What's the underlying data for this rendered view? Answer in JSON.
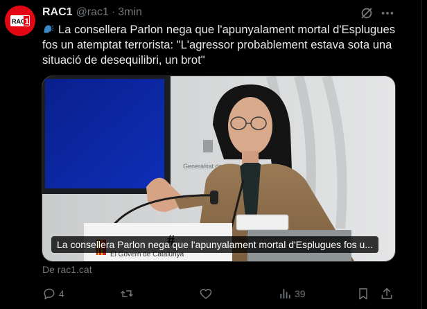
{
  "tweet": {
    "author_name": "RAC1",
    "handle": "@rac1",
    "separator": "·",
    "time": "3min",
    "avatar_text": "RAC1",
    "emoji": "speaking-head-emoji",
    "text": "La consellera Parlon nega que l'apunyalament mortal d'Esplugues fos un atemptat terrorista: \"L'agressor probablement estava sota una situació de desequilibri, un brot\"",
    "media": {
      "caption": "La consellera Parlon nega que l'apunyalament mortal d'Esplugues fos u...",
      "podium_text": "El Govern de Catalunya",
      "wall_text": "Generalitat de"
    },
    "source": "De rac1.cat",
    "actions": {
      "reply_count": "4",
      "retweet_count": "",
      "like_count": "",
      "views_count": "39"
    }
  },
  "colors": {
    "background": "#000000",
    "text": "#e7e9ea",
    "muted": "#71767b",
    "border": "#2f3336",
    "brand": "#e30613"
  }
}
